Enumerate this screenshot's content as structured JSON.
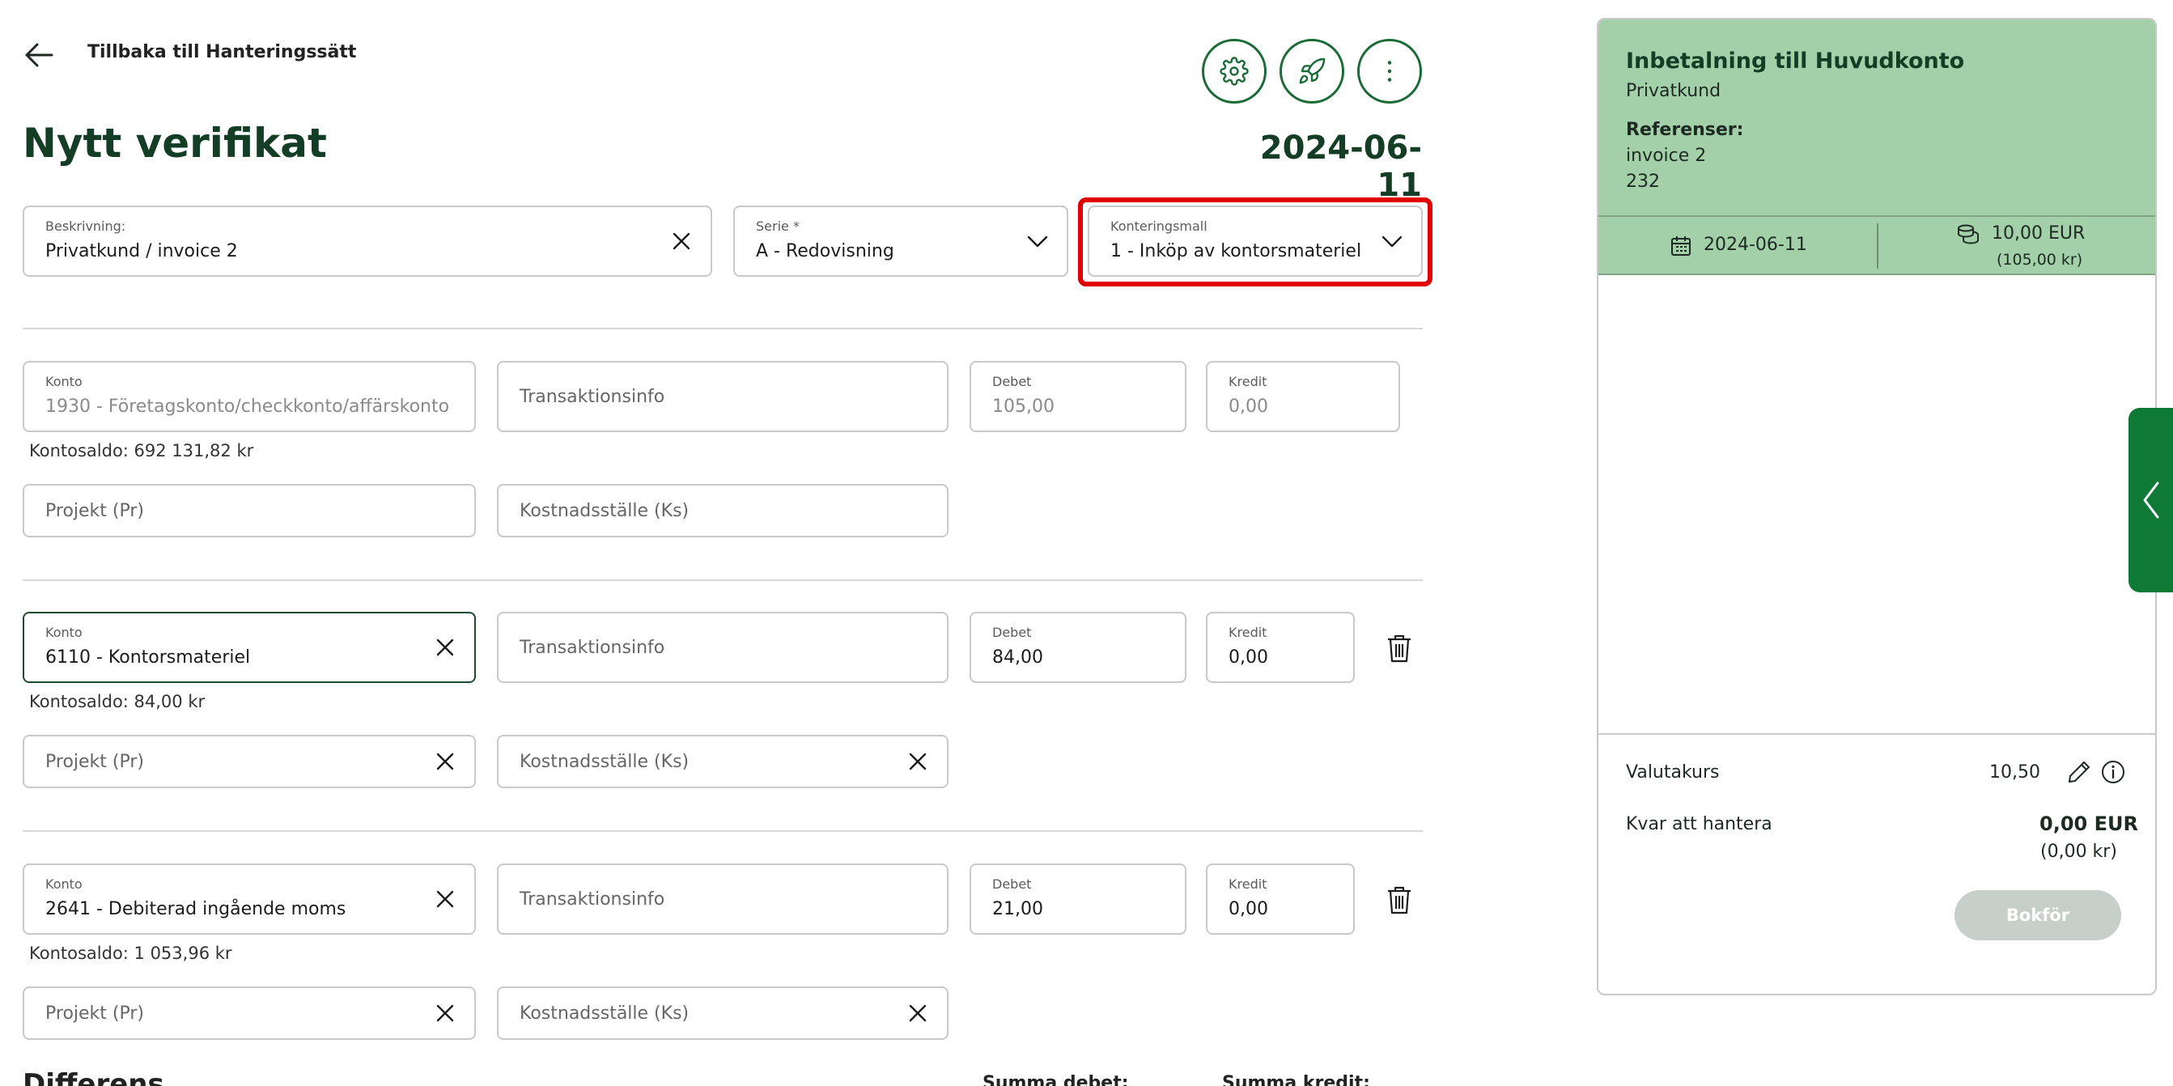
{
  "header": {
    "back_label": "Tillbaka till Hanteringssätt",
    "title": "Nytt verifikat",
    "date": "2024-06-11"
  },
  "top_fields": {
    "beskrivning": {
      "label": "Beskrivning:",
      "value": "Privatkund / invoice 2"
    },
    "serie": {
      "label": "Serie *",
      "value": "A - Redovisning"
    },
    "konteringsmall": {
      "label": "Konteringsmall",
      "value": "1 - Inköp av kontorsmateriel"
    }
  },
  "labels": {
    "konto": "Konto",
    "debet": "Debet",
    "kredit": "Kredit",
    "transaktionsinfo": "Transaktionsinfo",
    "projekt": "Projekt (Pr)",
    "kostnadsstalle": "Kostnadsställe (Ks)"
  },
  "rows": [
    {
      "konto": "1930 - Företagskonto/checkkonto/affärskonto",
      "debet": "105,00",
      "kredit": "0,00",
      "saldo": "Kontosaldo: 692 131,82 kr"
    },
    {
      "konto": "6110 - Kontorsmateriel",
      "debet": "84,00",
      "kredit": "0,00",
      "saldo": "Kontosaldo: 84,00 kr"
    },
    {
      "konto": "2641 - Debiterad ingående moms",
      "debet": "21,00",
      "kredit": "0,00",
      "saldo": "Kontosaldo: 1 053,96 kr"
    }
  ],
  "footer_cut": {
    "diff": "Differens",
    "summa_debet": "Summa debet:",
    "summa_kredit": "Summa kredit:"
  },
  "panel": {
    "title": "Inbetalning till Huvudkonto",
    "subtitle": "Privatkund",
    "ref_label": "Referenser:",
    "refs": [
      "invoice 2",
      "232"
    ],
    "date": "2024-06-11",
    "amount": "10,00 EUR",
    "amount_sek": "(105,00 kr)",
    "valutakurs_label": "Valutakurs",
    "valutakurs_value": "10,50",
    "kvar_label": "Kvar att hantera",
    "kvar_value": "0,00 EUR",
    "kvar_sek": "(0,00 kr)",
    "bokfor_label": "Bokför"
  },
  "colors": {
    "brand_green": "#1a6b35",
    "panel_green": "#a3cfa9",
    "highlight_red": "#e00000"
  },
  "icons": [
    "arrow-left-icon",
    "gear-icon",
    "rocket-icon",
    "more-vertical-icon",
    "close-icon",
    "chevron-down-icon",
    "trash-icon",
    "calendar-icon",
    "coins-icon",
    "pencil-icon",
    "info-icon",
    "chevron-left-icon"
  ]
}
